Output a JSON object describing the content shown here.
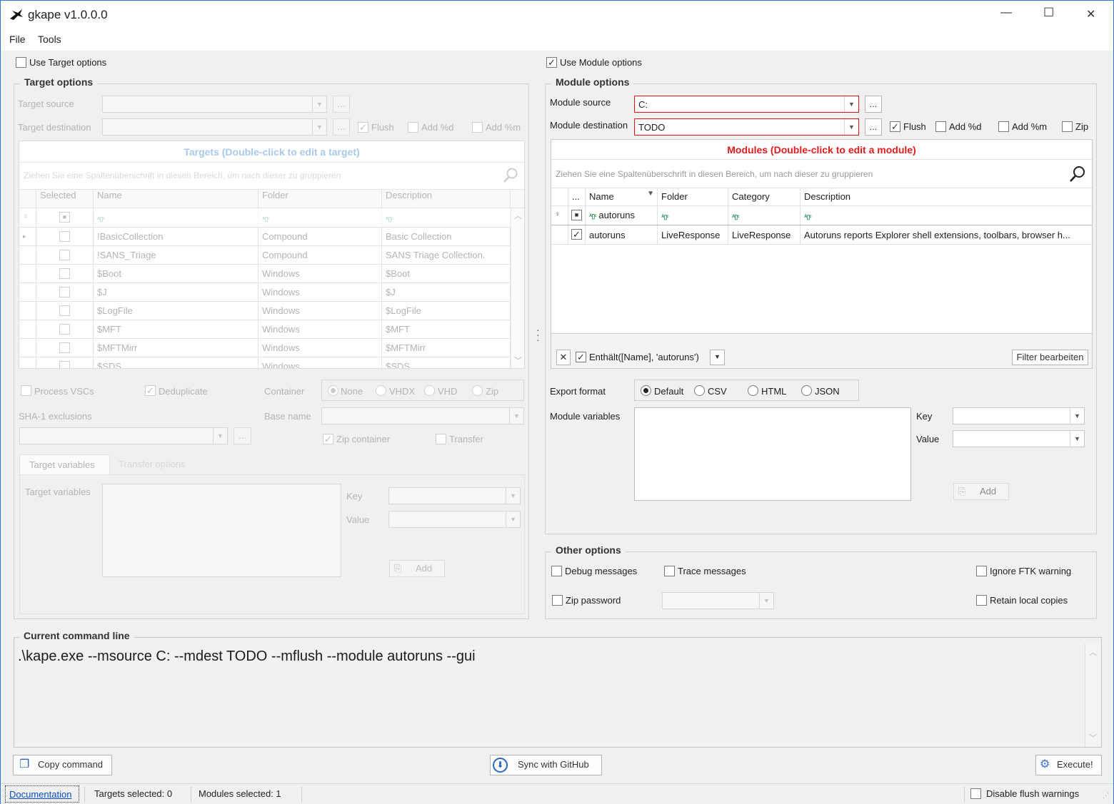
{
  "window": {
    "title": "gkape v1.0.0.0",
    "minimize_glyph": "—",
    "maximize_glyph": "☐",
    "close_glyph": "✕"
  },
  "menu": {
    "file": "File",
    "tools": "Tools"
  },
  "target": {
    "use_label": "Use Target options",
    "group_title": "Target options",
    "source_label": "Target source",
    "destination_label": "Target destination",
    "flush_label": "Flush",
    "add_d_label": "Add %d",
    "add_m_label": "Add %m",
    "browse": "...",
    "grid_title": "Targets (Double-click to edit a target)",
    "group_hint": "Ziehen Sie eine Spaltenüberschrift in diesen Bereich, um nach dieser zu gruppieren",
    "columns": [
      "Selected",
      "Name",
      "Folder",
      "Description"
    ],
    "filter_glyph": "ᴮʙᴄ",
    "rows": [
      {
        "name": "!BasicCollection",
        "folder": "Compound",
        "description": "Basic Collection"
      },
      {
        "name": "!SANS_Triage",
        "folder": "Compound",
        "description": "SANS Triage Collection."
      },
      {
        "name": "$Boot",
        "folder": "Windows",
        "description": "$Boot"
      },
      {
        "name": "$J",
        "folder": "Windows",
        "description": "$J"
      },
      {
        "name": "$LogFile",
        "folder": "Windows",
        "description": "$LogFile"
      },
      {
        "name": "$MFT",
        "folder": "Windows",
        "description": "$MFT"
      },
      {
        "name": "$MFTMirr",
        "folder": "Windows",
        "description": "$MFTMirr"
      },
      {
        "name": "$SDS",
        "folder": "Windows",
        "description": "$SDS"
      }
    ],
    "process_vscs": "Process VSCs",
    "deduplicate": "Deduplicate",
    "container_label": "Container",
    "container_options": [
      "None",
      "VHDX",
      "VHD",
      "Zip"
    ],
    "sha1_label": "SHA-1 exclusions",
    "base_name_label": "Base name",
    "zip_container": "Zip container",
    "transfer": "Transfer",
    "tab_vars": "Target variables",
    "tab_transfer": "Transfer options",
    "vars_label": "Target variables",
    "key_label": "Key",
    "value_label": "Value",
    "add_label": "Add"
  },
  "module": {
    "use_label": "Use Module options",
    "group_title": "Module options",
    "source_label": "Module source",
    "source_value": "C:",
    "destination_label": "Module destination",
    "destination_value": "TODO",
    "browse": "...",
    "flush_label": "Flush",
    "add_d_label": "Add %d",
    "add_m_label": "Add %m",
    "zip_label": "Zip",
    "grid_title": "Modules (Double-click to edit a module)",
    "group_hint": "Ziehen Sie eine Spaltenüberschrift in diesen Bereich, um nach dieser zu gruppieren",
    "columns": [
      "...",
      "Name",
      "Folder",
      "Category",
      "Description"
    ],
    "filter_name": "autoruns",
    "rows": [
      {
        "name": "autoruns",
        "folder": "LiveResponse",
        "category": "LiveResponse",
        "description": "Autoruns reports Explorer shell extensions, toolbars, browser h..."
      }
    ],
    "filter_expr": "Enthält([Name], 'autoruns')",
    "filter_edit": "Filter bearbeiten",
    "export_label": "Export format",
    "export_options": [
      "Default",
      "CSV",
      "HTML",
      "JSON"
    ],
    "vars_label": "Module variables",
    "key_label": "Key",
    "value_label": "Value",
    "add_label": "Add"
  },
  "other": {
    "group_title": "Other options",
    "debug": "Debug messages",
    "trace": "Trace messages",
    "ignore_ftk": "Ignore FTK warning",
    "zip_password": "Zip password",
    "retain_local": "Retain local copies"
  },
  "command": {
    "group_title": "Current command line",
    "text": ".\\kape.exe --msource C: --mdest TODO --mflush --module autoruns --gui"
  },
  "buttons": {
    "copy": "Copy command",
    "sync": "Sync with GitHub",
    "execute": "Execute!"
  },
  "status": {
    "documentation": "Documentation",
    "targets_selected": "Targets selected: 0",
    "modules_selected": "Modules selected: 1",
    "disable_flush": "Disable flush warnings"
  }
}
